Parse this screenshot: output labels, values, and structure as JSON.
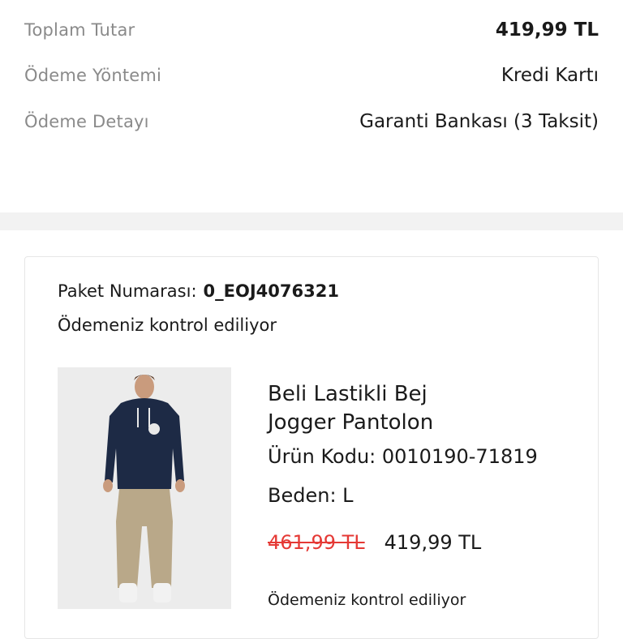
{
  "summary": {
    "rows": [
      {
        "label": "Toplam Tutar",
        "value": "419,99 TL"
      },
      {
        "label": "Ödeme Yöntemi",
        "value": "Kredi Kartı"
      },
      {
        "label": "Ödeme Detayı",
        "value": "Garanti Bankası (3 Taksit)"
      }
    ]
  },
  "package": {
    "number_label": "Paket Numarası:",
    "number_value": "0_EOJ4076321",
    "status": "Ödemeniz kontrol ediliyor"
  },
  "product": {
    "name_line1": "Beli Lastikli Bej",
    "name_line2": "Jogger Pantolon",
    "code": "Ürün Kodu: 0010190-71819",
    "size": "Beden: L",
    "old_price": "461,99 TL",
    "new_price": "419,99 TL",
    "status": "Ödemeniz kontrol ediliyor",
    "colors": {
      "hoodie": "#1d2a45",
      "pants": "#b9a889",
      "old_price": "#e53935"
    }
  }
}
